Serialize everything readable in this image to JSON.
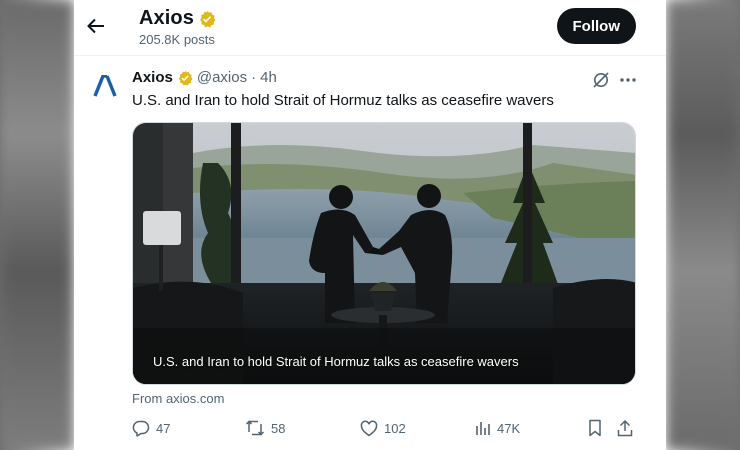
{
  "header": {
    "back_label": "Back",
    "name": "Axios",
    "posts_count": "205.8K posts",
    "follow_label": "Follow"
  },
  "tweet": {
    "author": "Axios",
    "handle": "@axios",
    "separator": "·",
    "time": "4h",
    "text": "U.S. and Iran to hold Strait of Hormuz talks as ceasefire wavers",
    "media_caption": "U.S. and Iran to hold Strait of Hormuz talks as ceasefire wavers",
    "source": "From axios.com",
    "actions": {
      "replies": "47",
      "reposts": "58",
      "likes": "102",
      "views": "47K"
    }
  },
  "colors": {
    "verified_gold": "#e2b719",
    "logo_blue": "#1a5ea8",
    "text_primary": "#0f1419",
    "text_secondary": "#536471",
    "follow_bg": "#0f1419"
  },
  "icons": [
    "back-arrow-icon",
    "verified-badge-icon",
    "axios-logo-icon",
    "grok-icon",
    "more-icon",
    "reply-icon",
    "repost-icon",
    "like-icon",
    "views-icon",
    "bookmark-icon",
    "share-icon"
  ]
}
